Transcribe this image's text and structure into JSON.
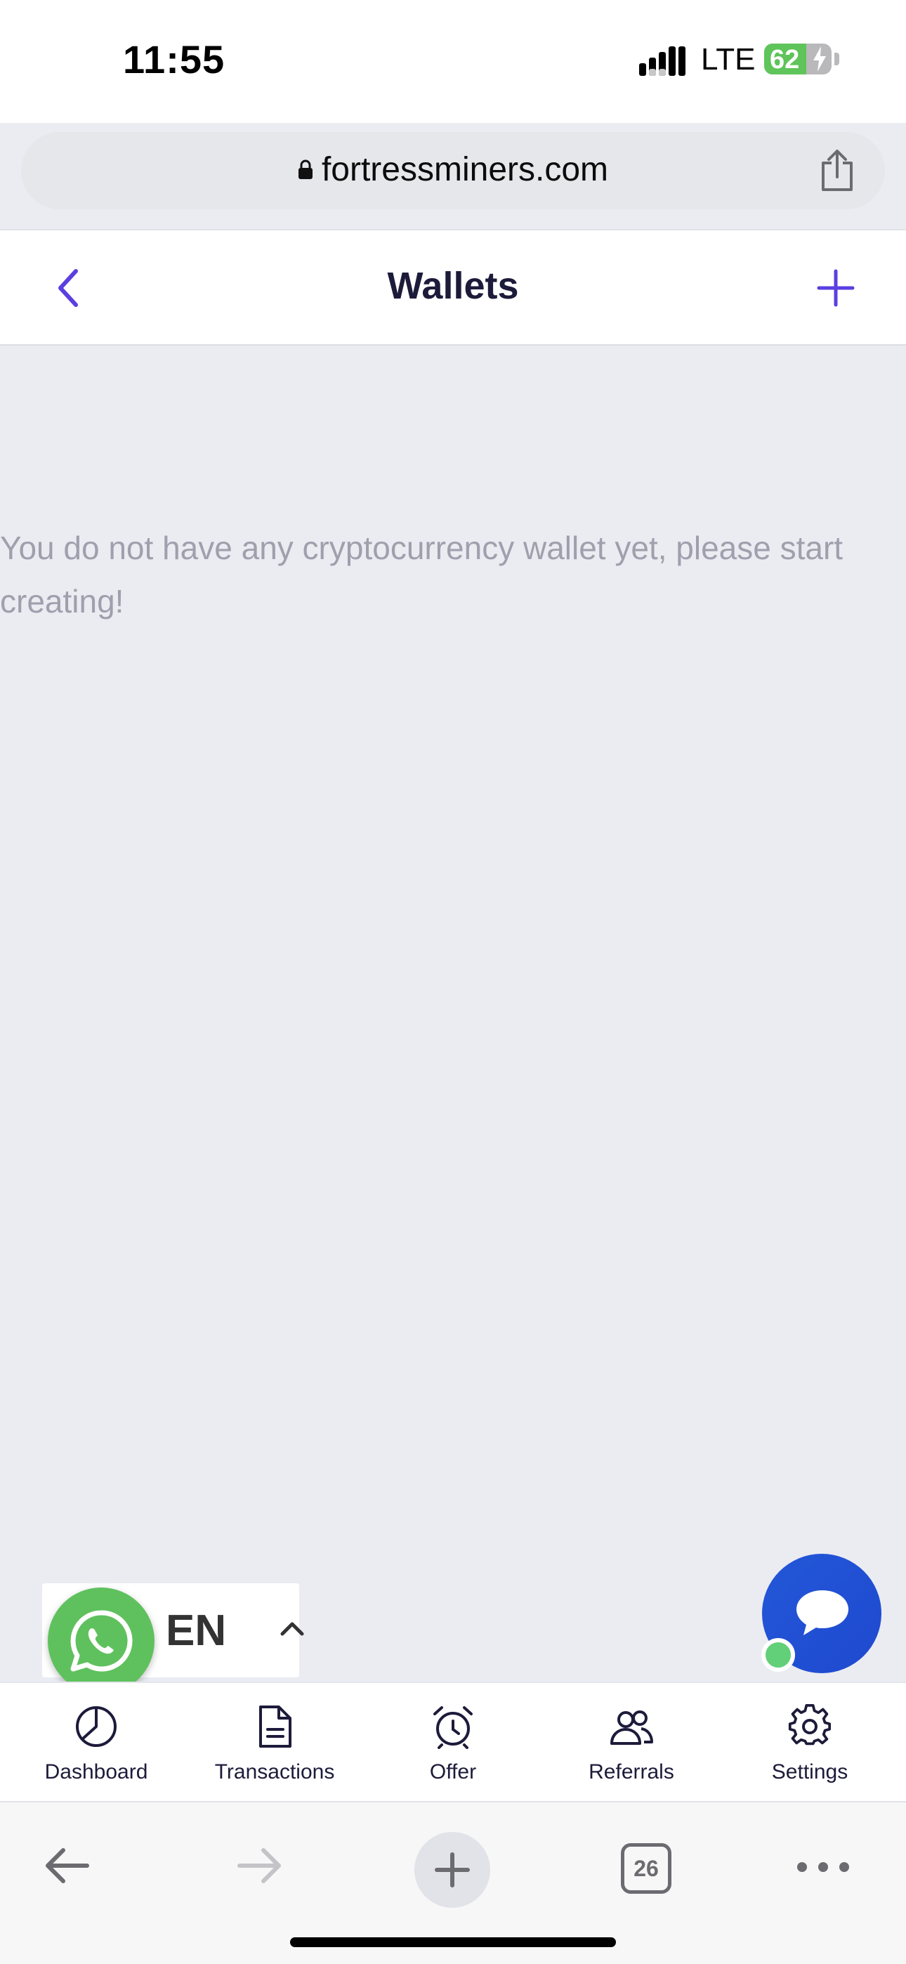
{
  "status_bar": {
    "time": "11:55",
    "network": "LTE",
    "battery_percent": "62",
    "battery_level": 0.62,
    "battery_color": "#5fc45a"
  },
  "browser": {
    "url": "fortressminers.com",
    "lock_icon": "lock-icon",
    "share_icon": "share-icon",
    "tab_count": "26"
  },
  "header": {
    "title": "Wallets",
    "back_icon": "chevron-left-icon",
    "add_icon": "plus-icon",
    "accent_color": "#5b3fe0"
  },
  "main": {
    "empty_message": "You do not have any cryptocurrency wallet yet, please start creating!"
  },
  "language": {
    "code": "EN",
    "whatsapp_icon": "whatsapp-icon"
  },
  "chat": {
    "icon": "chat-bubble-icon"
  },
  "bottom_nav": {
    "items": [
      {
        "label": "Dashboard",
        "icon": "pie-chart-icon"
      },
      {
        "label": "Transactions",
        "icon": "document-icon"
      },
      {
        "label": "Offer",
        "icon": "alarm-clock-icon"
      },
      {
        "label": "Referrals",
        "icon": "users-icon"
      },
      {
        "label": "Settings",
        "icon": "gear-icon"
      }
    ]
  }
}
